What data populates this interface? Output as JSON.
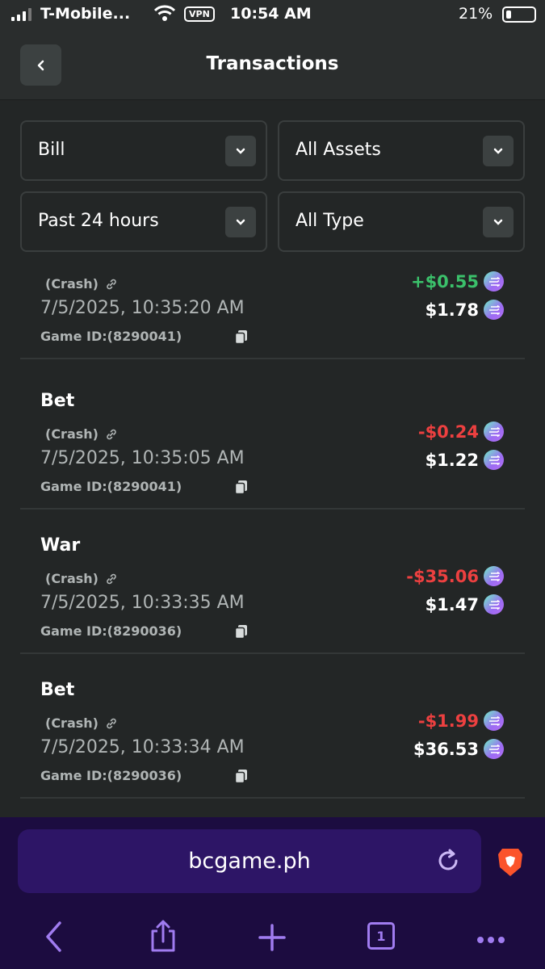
{
  "status_bar": {
    "carrier": "T-Mobile...",
    "vpn": "VPN",
    "time": "10:54 AM",
    "battery": "21%"
  },
  "header": {
    "title": "Transactions"
  },
  "filters": {
    "category": "Bill",
    "assets": "All Assets",
    "period": "Past 24 hours",
    "type": "All Type"
  },
  "transactions": [
    {
      "type": "",
      "game": "(Crash)",
      "time": "7/5/2025, 10:35:20 AM",
      "game_id": "Game ID:(8290041)",
      "amount": "+$0.55",
      "balance": "$1.78"
    },
    {
      "type": "Bet",
      "game": "(Crash)",
      "time": "7/5/2025, 10:35:05 AM",
      "game_id": "Game ID:(8290041)",
      "amount": "-$0.24",
      "balance": "$1.22"
    },
    {
      "type": "War",
      "game": "(Crash)",
      "time": "7/5/2025, 10:33:35 AM",
      "game_id": "Game ID:(8290036)",
      "amount": "-$35.06",
      "balance": "$1.47"
    },
    {
      "type": "Bet",
      "game": "(Crash)",
      "time": "7/5/2025, 10:33:34 AM",
      "game_id": "Game ID:(8290036)",
      "amount": "-$1.99",
      "balance": "$36.53"
    }
  ],
  "colors": {
    "positive": "#3bc16b",
    "negative": "#ed4040",
    "browser_bg": "#1c0c40"
  },
  "browser": {
    "url": "bcgame.ph",
    "tabs_count": "1"
  }
}
